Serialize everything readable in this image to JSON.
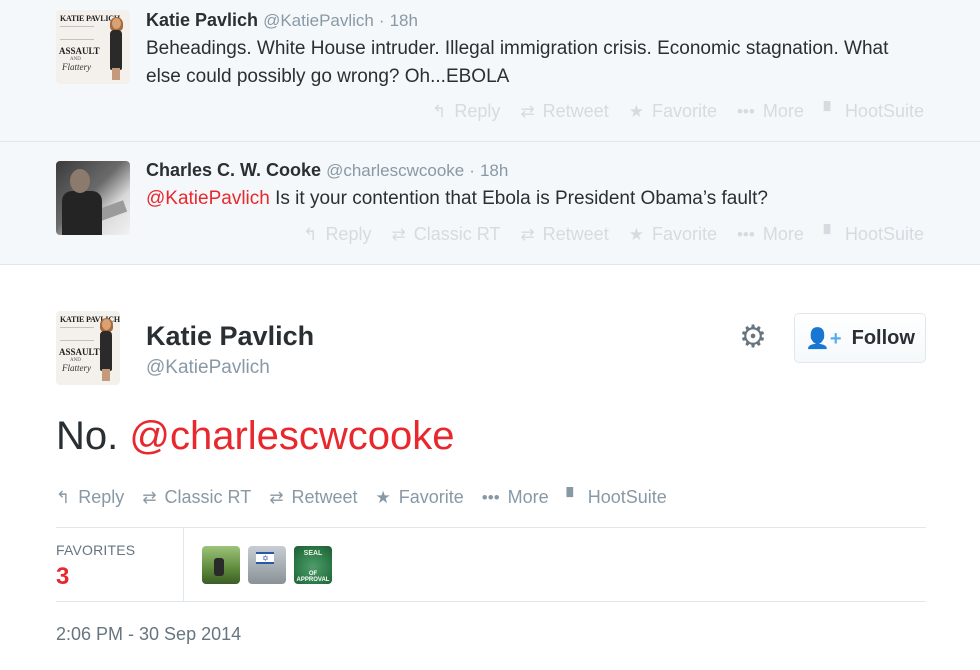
{
  "reply_tweets": [
    {
      "name": "Katie Pavlich",
      "handle": "@KatiePavlich",
      "dot": "·",
      "time": "18h",
      "text": "Beheadings. White House intruder. Illegal immigration crisis. Economic stagnation. What else could possibly go wrong? Oh...EBOLA",
      "actions": [
        "Reply",
        "Retweet",
        "Favorite",
        "More",
        "HootSuite"
      ]
    },
    {
      "name": "Charles C. W. Cooke",
      "handle": "@charlescwcooke",
      "dot": "·",
      "time": "18h",
      "mention": "@KatiePavlich",
      "text": " Is it your contention that Ebola is President Obama’s fault?",
      "actions": [
        "Reply",
        "Classic RT",
        "Retweet",
        "Favorite",
        "More",
        "HootSuite"
      ]
    }
  ],
  "book_cover": {
    "author": "KATIE PAVLICH",
    "title": "ASSAULT",
    "and": "AND",
    "subtitle": "Flattery"
  },
  "main_tweet": {
    "name": "Katie Pavlich",
    "handle": "@KatiePavlich",
    "follow_label": "Follow",
    "text_plain": "No. ",
    "text_mention": "@charlescwcooke",
    "actions": [
      "Reply",
      "Classic RT",
      "Retweet",
      "Favorite",
      "More",
      "HootSuite"
    ],
    "favorites_label": "FAVORITES",
    "favorites_count": "3",
    "favoriter_avatar_text": {
      "seal_top": "SEAL",
      "seal_bottom": "OF APPROVAL"
    },
    "timestamp": "2:06 PM - 30 Sep 2014"
  },
  "icons": {
    "reply": "reply-arrow-icon",
    "retweet": "retweet-icon",
    "favorite": "star-icon",
    "more": "ellipsis-icon",
    "hootsuite": "hootsuite-icon",
    "gear": "gear-icon",
    "follow": "add-person-icon"
  },
  "colors": {
    "mention": "#e8282d",
    "favorites_count": "#e8282d",
    "reply_bg": "#f5f8fa",
    "follow_icon": "#55acee",
    "muted_text": "#8899a6"
  }
}
